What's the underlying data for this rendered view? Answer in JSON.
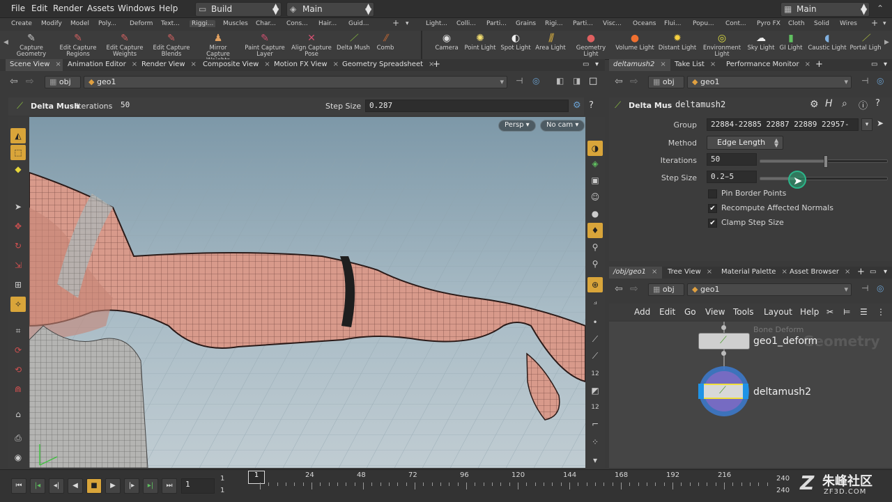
{
  "menubar": {
    "items": [
      "File",
      "Edit",
      "Render",
      "Assets",
      "Windows",
      "Help"
    ],
    "desktop": "Build",
    "context": "Main",
    "right_desktop": "Main"
  },
  "shelf": {
    "left_tabs": [
      "Create",
      "Modify",
      "Model",
      "Poly...",
      "Deform",
      "Text...",
      "Riggi...",
      "Muscles",
      "Char...",
      "Cons...",
      "Hair...",
      "Guid..."
    ],
    "right_tabs": [
      "Light...",
      "Colli...",
      "Parti...",
      "Grains",
      "Rigi...",
      "Parti...",
      "Visc...",
      "Oceans",
      "Flui...",
      "Popu...",
      "Cont...",
      "Pyro FX",
      "Cloth",
      "Solid",
      "Wires"
    ],
    "left_tools": [
      "Capture Geometry",
      "Edit Capture Regions",
      "Edit Capture Weights",
      "Edit Capture Blends",
      "Mirror Capture Weights",
      "Paint Capture Layer",
      "Align Capture Pose",
      "Delta Mush",
      "Comb"
    ],
    "right_tools": [
      "Camera",
      "Point Light",
      "Spot Light",
      "Area Light",
      "Geometry Light",
      "Volume Light",
      "Distant Light",
      "Environment Light",
      "Sky Light",
      "GI Light",
      "Caustic Light",
      "Portal Ligh"
    ]
  },
  "left_pane": {
    "tabs": [
      "Scene View",
      "Animation Editor",
      "Render View",
      "Composite View",
      "Motion FX View",
      "Geometry Spreadsheet"
    ],
    "path": [
      "obj",
      "geo1"
    ]
  },
  "operator": {
    "name": "Delta Mush",
    "iterations_label": "Iterations",
    "iterations": "50",
    "step_label": "Step Size",
    "step": "0.287"
  },
  "viewport": {
    "persp": "Persp",
    "cam": "No cam"
  },
  "param_pane": {
    "tabs": [
      "deltamush2",
      "Take List",
      "Performance Monitor"
    ],
    "path": [
      "obj",
      "geo1"
    ],
    "node_type": "Delta Mush",
    "node_name": "deltamush2",
    "group_label": "Group",
    "group_value": "22884-22885 22887 22889 22957-",
    "method_label": "Method",
    "method_value": "Edge Length",
    "iterations_label": "Iterations",
    "iterations_value": "50",
    "iterations_fraction": 0.5,
    "step_label": "Step Size",
    "step_value": "0.2̵5",
    "step_fraction": 0.28,
    "checkboxes": [
      {
        "label": "Pin Border Points",
        "checked": false
      },
      {
        "label": "Recompute Affected Normals",
        "checked": true
      },
      {
        "label": "Clamp Step Size",
        "checked": true
      }
    ]
  },
  "network_pane": {
    "tabs": [
      "/obj/geo1",
      "Tree View",
      "Material Palette",
      "Asset Browser"
    ],
    "path": [
      "obj",
      "geo1"
    ],
    "menu": [
      "Add",
      "Edit",
      "Go",
      "View",
      "Tools",
      "Layout",
      "Help"
    ],
    "nodes": [
      {
        "type_label": "Bone Deform",
        "name": "geo1_deform"
      },
      {
        "type_label": "",
        "name": "deltamush2"
      }
    ],
    "watermark": "Geometry"
  },
  "timeline": {
    "current_frame": "1",
    "start": "1",
    "start2": "1",
    "marker": "1",
    "ticks": [
      "24",
      "48",
      "72",
      "96",
      "120",
      "144",
      "168",
      "192",
      "216"
    ],
    "end": "240",
    "end2": "240"
  },
  "brand": {
    "logo_cn": "朱峰社区",
    "logo_url": "ZF3D.COM"
  },
  "colors": {
    "accent_orange": "#e8a33a",
    "node_selected": "#f3e03a",
    "node_blue": "#1f93e6",
    "skin": "#d98b7c"
  }
}
